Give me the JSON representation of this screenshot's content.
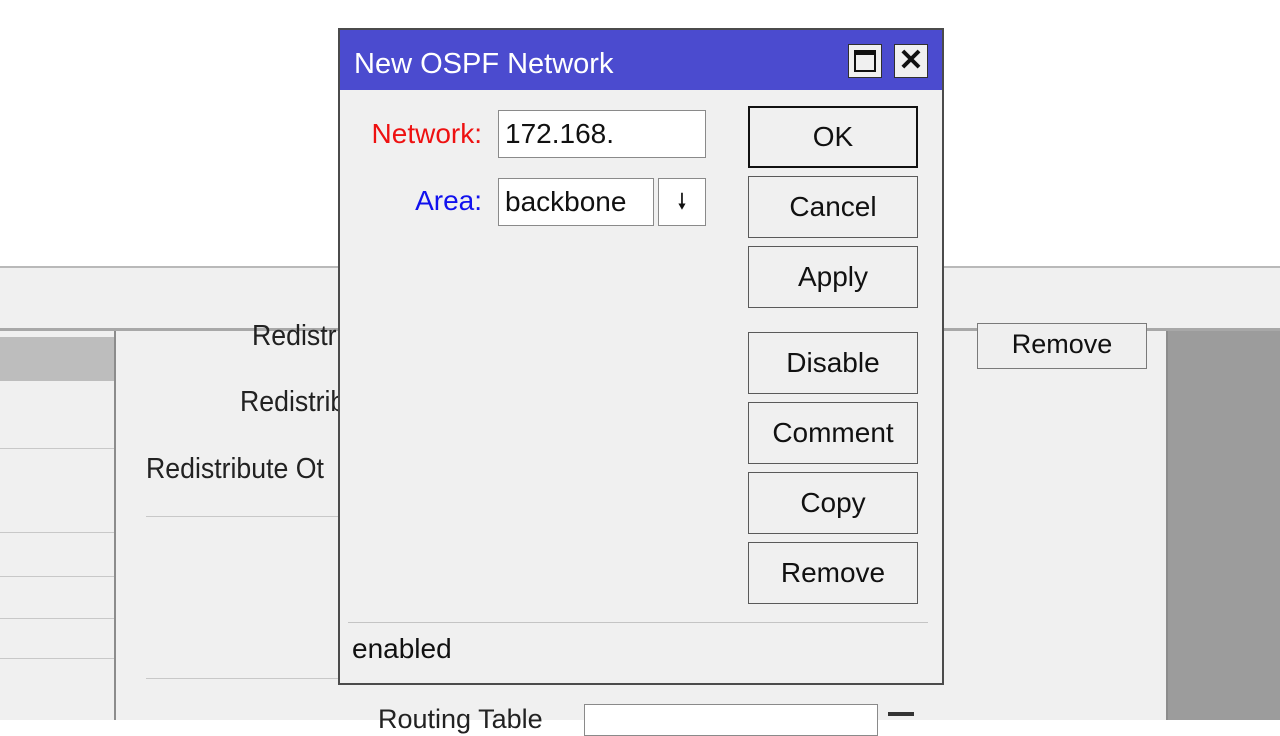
{
  "background_window": {
    "labels": [
      "Redistri",
      "Redistrib",
      "Redistribute Ot"
    ],
    "remove_button": "Remove",
    "bottom_label": "Routing Table"
  },
  "dialog": {
    "title": "New OSPF Network",
    "network": {
      "label": "Network:",
      "value": "172.168.",
      "label_color": "#ee1111"
    },
    "area": {
      "label": "Area:",
      "value": "backbone",
      "label_color": "#1111ee"
    },
    "buttons": {
      "ok": "OK",
      "cancel": "Cancel",
      "apply": "Apply",
      "disable": "Disable",
      "comment": "Comment",
      "copy": "Copy",
      "remove": "Remove"
    },
    "status": "enabled",
    "titlebar_color": "#4b4bcf"
  }
}
